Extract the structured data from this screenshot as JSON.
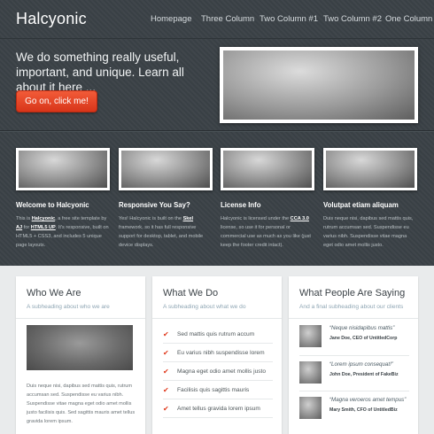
{
  "header": {
    "logo": "Halcyonic",
    "nav": [
      "Homepage",
      "Three Column",
      "Two Column #1",
      "Two Column #2",
      "One Column"
    ]
  },
  "hero": {
    "headline": "We do something really useful, important, and unique. Learn all about it here ...",
    "cta_label": "Go on, click me!"
  },
  "features": [
    {
      "title": "Welcome to Halcyonic",
      "text_a": "This is ",
      "link_a": "Halcyonic",
      "text_b": ", a free site template by ",
      "link_b": "AJ",
      "text_c": " for ",
      "link_c": "HTML5 UP",
      "text_d": ". It's responsive, built on HTML5 + CSS3, and includes 5 unique page layouts."
    },
    {
      "title": "Responsive You Say?",
      "text_a": "Yes! Halcyonic is built on the ",
      "link_a": "Skel",
      "text_b": " framework, so it has full responsive support for desktop, tablet, and mobile device displays."
    },
    {
      "title": "License Info",
      "text_a": "Halcyonic is licensed under the ",
      "link_a": "CCA 3.0",
      "text_b": " license, so use it for personal or commercial use as much as you like (just keep the footer credit intact)."
    },
    {
      "title": "Volutpat etiam aliquam",
      "text_a": "Duis neque nisi, dapibus sed mattis quis, rutrum accumsan sed. Suspendisse eu varius nibh. Suspendisse vitae magna eget odio amet mollis justo."
    }
  ],
  "who": {
    "title": "Who We Are",
    "subtitle": "A subheading about who we are",
    "body": "Duis neque nisi, dapibus sed mattis quis, rutrum accumsan sed. Suspendisse eu varius nibh. Suspendisse vitae magna eget odio amet mollis justo facilisis quis. Sed sagittis mauris amet tellus gravida lorem ipsum."
  },
  "what": {
    "title": "What We Do",
    "subtitle": "A subheading about what we do",
    "items": [
      "Sed mattis quis rutrum accum",
      "Eu varius nibh suspendisse lorem",
      "Magna eget odio amet mollis justo",
      "Facilisis quis sagittis mauris",
      "Amet tellus gravida lorem ipsum"
    ]
  },
  "people": {
    "title": "What People Are Saying",
    "subtitle": "And a final subheading about our clients",
    "quotes": [
      {
        "text": "“Neque nisidapibus mattis”",
        "author": "Jane Doe, CEO of UntitledCorp"
      },
      {
        "text": "“Lorem ipsum consequat!”",
        "author": "John Doe, President of FakeBiz"
      },
      {
        "text": "“Magna veroeros amet tempus”",
        "author": "Mary Smith, CFO of UntitledBiz"
      }
    ]
  },
  "icons": {
    "check": "checkmark-icon"
  },
  "colors": {
    "accent": "#e03a1e",
    "dark_bg": "#3b4247",
    "subheading": "#8ea5b3"
  }
}
